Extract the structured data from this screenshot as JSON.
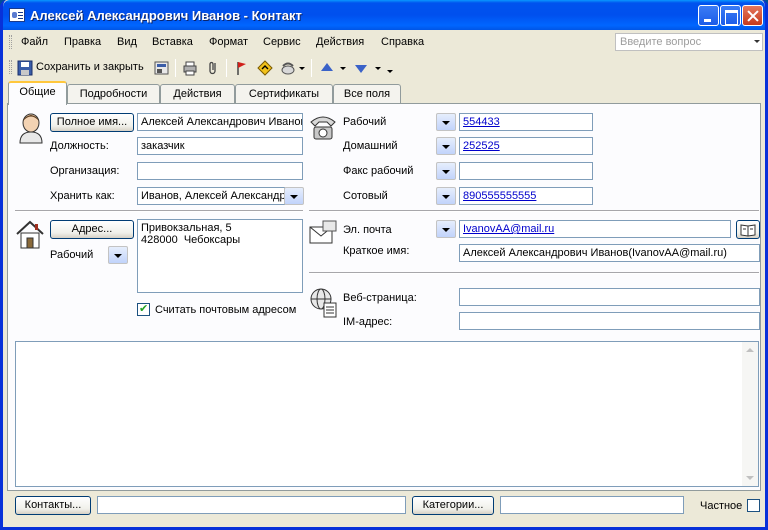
{
  "window": {
    "title": "Алексей Александрович Иванов - Контакт"
  },
  "menu": [
    "Файл",
    "Правка",
    "Вид",
    "Вставка",
    "Формат",
    "Сервис",
    "Действия",
    "Справка"
  ],
  "ask_placeholder": "Введите вопрос",
  "toolbar": {
    "save_close": "Сохранить и закрыть"
  },
  "tabs": [
    "Общие",
    "Подробности",
    "Действия",
    "Сертификаты",
    "Все поля"
  ],
  "name_section": {
    "full_name_button": "Полное имя...",
    "full_name_value": "Алексей Александрович Иванов",
    "job_title_label": "Должность:",
    "job_title_value": "заказчик",
    "company_label": "Организация:",
    "company_value": "",
    "file_as_label": "Хранить как:",
    "file_as_value": "Иванов, Алексей Александрович"
  },
  "phones": [
    {
      "label": "Рабочий",
      "value": "554433"
    },
    {
      "label": "Домашний",
      "value": "252525"
    },
    {
      "label": "Факс рабочий",
      "value": ""
    },
    {
      "label": "Сотовый",
      "value": "890555555555"
    }
  ],
  "address": {
    "button": "Адрес...",
    "type": "Рабочий",
    "line1": "Привокзальная, 5",
    "line2": "428000  Чебоксары",
    "mailing_label": "Считать почтовым адресом",
    "mailing_checked": true
  },
  "email": {
    "label": "Эл. почта",
    "value": "IvanovAA@mail.ru",
    "display_label": "Краткое имя:",
    "display_value": "Алексей Александрович Иванов(IvanovAA@mail.ru)"
  },
  "web": {
    "web_label": "Веб-страница:",
    "web_value": "",
    "im_label": "IM-адрес:",
    "im_value": ""
  },
  "bottom": {
    "contacts_button": "Контакты...",
    "contacts_value": "",
    "categories_button": "Категории...",
    "categories_value": "",
    "private_label": "Частное",
    "private_checked": false
  },
  "colors": {
    "title_blue": "#0053ee",
    "link": "#0000cc",
    "face": "#ece9d8"
  }
}
